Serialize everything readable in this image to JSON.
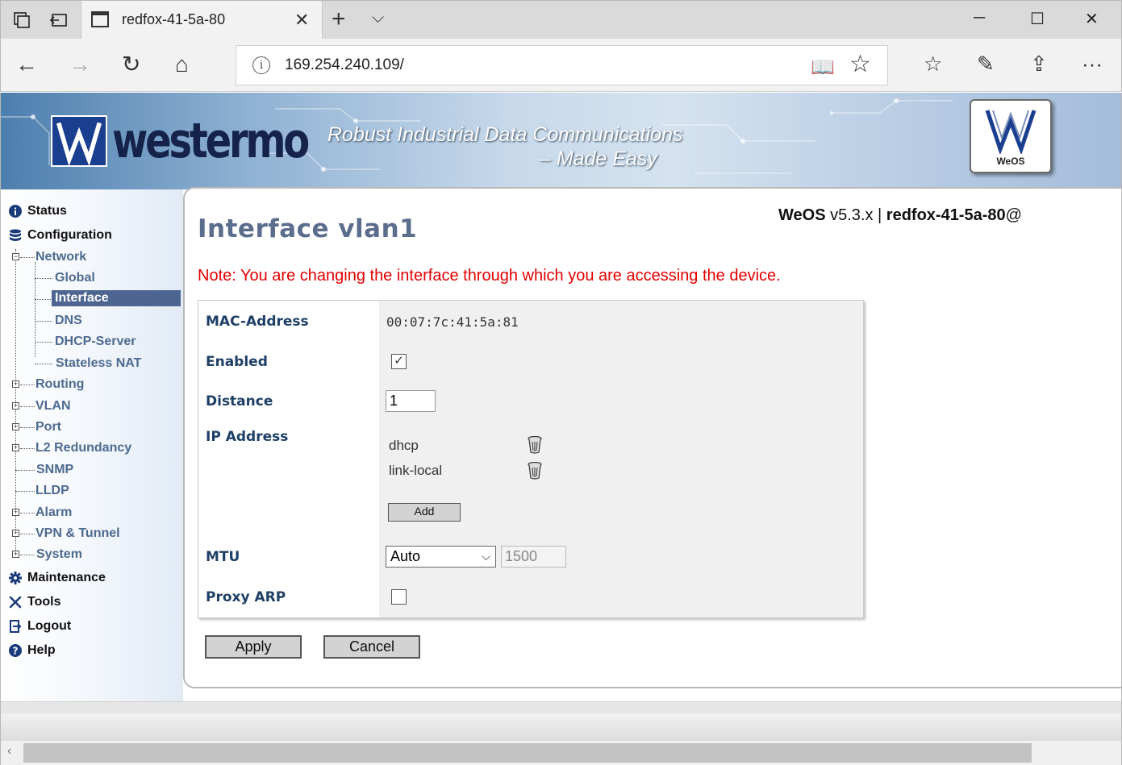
{
  "browser": {
    "tab_title": "redfox-41-5a-80",
    "url": "169.254.240.109/",
    "info_glyph": "i",
    "close_glyph": "✕",
    "new_tab_glyph": "+",
    "tab_menu_glyph": "⌵",
    "back_glyph": "←",
    "forward_glyph": "→",
    "refresh_glyph": "↻",
    "home_glyph": "⌂",
    "read_glyph": "📖",
    "fav_glyph": "☆",
    "favorites_glyph": "☆",
    "notes_glyph": "✎",
    "share_glyph": "⇪",
    "more_glyph": "···",
    "minimize_glyph": "─",
    "maximize_glyph": "☐",
    "winclose_glyph": "✕"
  },
  "banner": {
    "logo_text": "westermo",
    "tagline_1": "Robust Industrial Data Communications",
    "tagline_2": "– Made Easy",
    "badge_text": "WeOS"
  },
  "sidebar": {
    "status": "Status",
    "configuration": "Configuration",
    "network": "Network",
    "global": "Global",
    "interface": "Interface",
    "dns": "DNS",
    "dhcp_server": "DHCP-Server",
    "stateless_nat": "Stateless NAT",
    "routing": "Routing",
    "vlan": "VLAN",
    "port": "Port",
    "l2_redundancy": "L2 Redundancy",
    "snmp": "SNMP",
    "lldp": "LLDP",
    "alarm": "Alarm",
    "vpn_tunnel": "VPN & Tunnel",
    "system": "System",
    "maintenance": "Maintenance",
    "tools": "Tools",
    "logout": "Logout",
    "help": "Help"
  },
  "main": {
    "title": "Interface vlan1",
    "os_name": "WeOS",
    "os_version": " v5.3.x | ",
    "hostname": "redfox-41-5a-80",
    "at": "@",
    "note": "Note: You are changing the interface through which you are accessing the device."
  },
  "form": {
    "mac_label": "MAC-Address",
    "mac_value": "00:07:7c:41:5a:81",
    "enabled_label": "Enabled",
    "enabled_checked": true,
    "distance_label": "Distance",
    "distance_value": "1",
    "ip_label": "IP Address",
    "ip_entries": [
      "dhcp",
      "link-local"
    ],
    "add_label": "Add",
    "mtu_label": "MTU",
    "mtu_selected": "Auto",
    "mtu_value": "1500",
    "proxy_arp_label": "Proxy ARP",
    "proxy_arp_checked": false
  },
  "actions": {
    "apply": "Apply",
    "cancel": "Cancel"
  },
  "colors": {
    "note_red": "#e30000",
    "label_blue": "#1e3f66",
    "nav_text": "#4d6a8f",
    "nav_selected_bg": "#4d6590"
  }
}
